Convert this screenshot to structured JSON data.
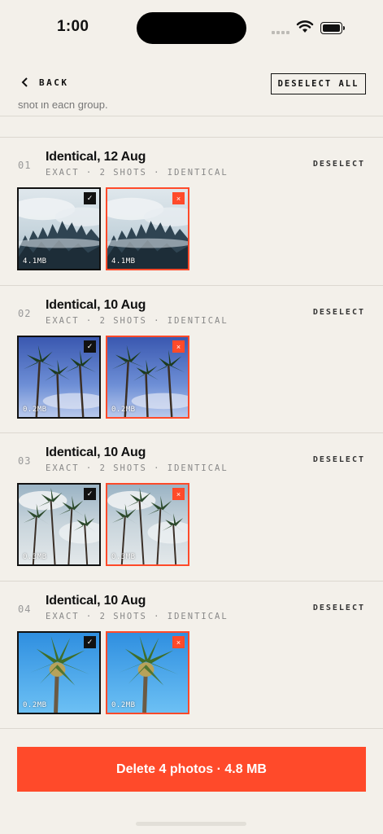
{
  "status_bar": {
    "time": "1:00"
  },
  "header": {
    "back_label": "BACK",
    "deselect_all_label": "DESELECT ALL"
  },
  "intro_text": "shot in each group.",
  "colors": {
    "accent": "#ff4a2a",
    "background": "#f3f0ea",
    "text": "#111111"
  },
  "groups": [
    {
      "index": "01",
      "title": "Identical, 12 Aug",
      "meta": "EXACT · 2 SHOTS · IDENTICAL",
      "deselect_label": "DESELECT",
      "photo_subject": "misty-forest",
      "keep": {
        "size": "4.1MB",
        "badge": "✓"
      },
      "delete": {
        "size": "4.1MB",
        "badge": "×"
      }
    },
    {
      "index": "02",
      "title": "Identical, 10 Aug",
      "meta": "EXACT · 2 SHOTS · IDENTICAL",
      "deselect_label": "DESELECT",
      "photo_subject": "palm-trees-blue-sky",
      "keep": {
        "size": "0.2MB",
        "badge": "✓"
      },
      "delete": {
        "size": "0.2MB",
        "badge": "×"
      }
    },
    {
      "index": "03",
      "title": "Identical, 10 Aug",
      "meta": "EXACT · 2 SHOTS · IDENTICAL",
      "deselect_label": "DESELECT",
      "photo_subject": "palm-trees-cloudy-sky",
      "keep": {
        "size": "0.3MB",
        "badge": "✓"
      },
      "delete": {
        "size": "0.3MB",
        "badge": "×"
      }
    },
    {
      "index": "04",
      "title": "Identical, 10 Aug",
      "meta": "EXACT · 2 SHOTS · IDENTICAL",
      "deselect_label": "DESELECT",
      "photo_subject": "single-palm-clear-sky",
      "keep": {
        "size": "0.2MB",
        "badge": "✓"
      },
      "delete": {
        "size": "0.2MB",
        "badge": "×"
      }
    }
  ],
  "delete_button": {
    "label": "Delete 4 photos · 4.8 MB"
  }
}
